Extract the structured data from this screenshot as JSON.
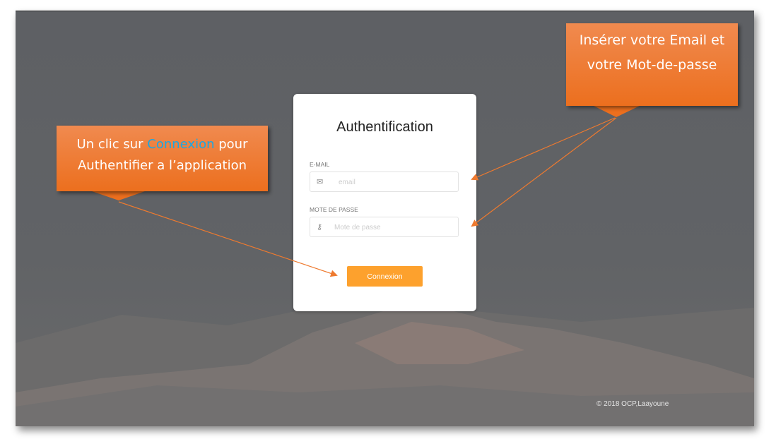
{
  "login": {
    "title": "Authentification",
    "email_label": "E-MAIL",
    "email_placeholder": "email",
    "password_label": "MOTE DE PASSE",
    "password_placeholder": "Mote de passe",
    "submit_label": "Connexion"
  },
  "footer": {
    "copyright": "© 2018 OCP,Laayoune"
  },
  "annotations": {
    "left_prefix": "Un clic sur ",
    "left_highlight": "Connexion",
    "left_suffix": " pour",
    "left_line2": "Authentifier a l’application",
    "right_text": "Insérer votre Email et votre Mot-de-passe"
  },
  "colors": {
    "accent": "#fda12d",
    "callout": "#ee7a2f",
    "highlight": "#1aa7e4"
  }
}
